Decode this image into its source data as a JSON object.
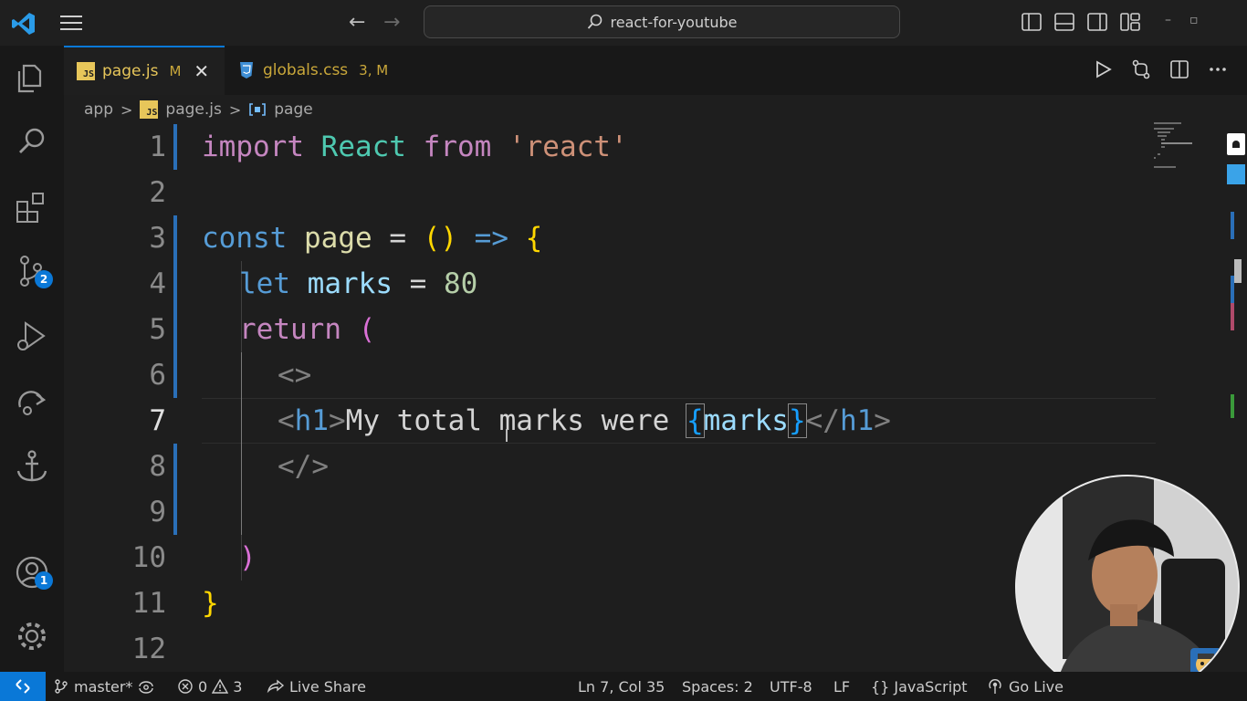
{
  "titlebar": {
    "search_text": "react-for-youtube",
    "back_arrow": "←",
    "forward_arrow": "→",
    "minimize": "–",
    "restore": "▫"
  },
  "activity_bar": {
    "source_control_badge": "2",
    "accounts_badge": "1"
  },
  "tabs": [
    {
      "label": "page.js",
      "status": "M",
      "icon": "JS",
      "close": "✕"
    },
    {
      "label": "globals.css",
      "status": "3, M"
    }
  ],
  "breadcrumb": {
    "folder": "app",
    "file": "page.js",
    "symbol": "page",
    "file_icon": "JS",
    "separator": ">"
  },
  "editor": {
    "line_numbers": [
      "1",
      "2",
      "3",
      "4",
      "5",
      "6",
      "7",
      "8",
      "9",
      "10",
      "11",
      "12"
    ],
    "current_line": "7",
    "code": {
      "l1_import": "import",
      "l1_react": "React",
      "l1_from": "from",
      "l1_str": "'react'",
      "l3_const": "const",
      "l3_name": "page",
      "l3_eq": "=",
      "l3_parens": "()",
      "l3_arrow": "=>",
      "l3_brace": "{",
      "l4_let": "let",
      "l4_var": "marks",
      "l4_eq": "=",
      "l4_num": "80",
      "l5_return": "return",
      "l5_paren": "(",
      "l6_fragment": "<>",
      "l7_open_lt": "<",
      "l7_open_tag": "h1",
      "l7_open_gt": ">",
      "l7_text": "My total marks were ",
      "l7_lbrace": "{",
      "l7_expr": "marks",
      "l7_rbrace": "}",
      "l7_close_lt": "</",
      "l7_close_tag": "h1",
      "l7_close_gt": ">",
      "l8_fragment_close": "</>",
      "l10_paren": ")",
      "l11_brace": "}"
    }
  },
  "status_bar": {
    "branch": "master*",
    "errors": "0",
    "warnings": "3",
    "live_share": "Live Share",
    "cursor_position": "Ln 7, Col 35",
    "spaces": "Spaces: 2",
    "encoding": "UTF-8",
    "eol": "LF",
    "language_braces": "{}",
    "language": "JavaScript",
    "go_live": "Go Live"
  },
  "colors": {
    "accent": "#0a78d7",
    "keyword_control": "#c586c0",
    "keyword": "#569cd6",
    "variable": "#9cdcfe",
    "function": "#dcdcaa",
    "class": "#4ec9b0",
    "string": "#ce9178",
    "number": "#b5cea8",
    "modified_file": "#e7c65a"
  },
  "icons": {
    "activity": [
      "explorer-icon",
      "search-icon",
      "extensions-icon",
      "source-control-icon",
      "run-debug-icon",
      "remote-explorer-icon",
      "anchor-icon",
      "accounts-icon",
      "settings-gear-icon"
    ],
    "tab_actions": [
      "run-icon",
      "compare-changes-icon",
      "split-editor-icon",
      "more-icon"
    ]
  }
}
